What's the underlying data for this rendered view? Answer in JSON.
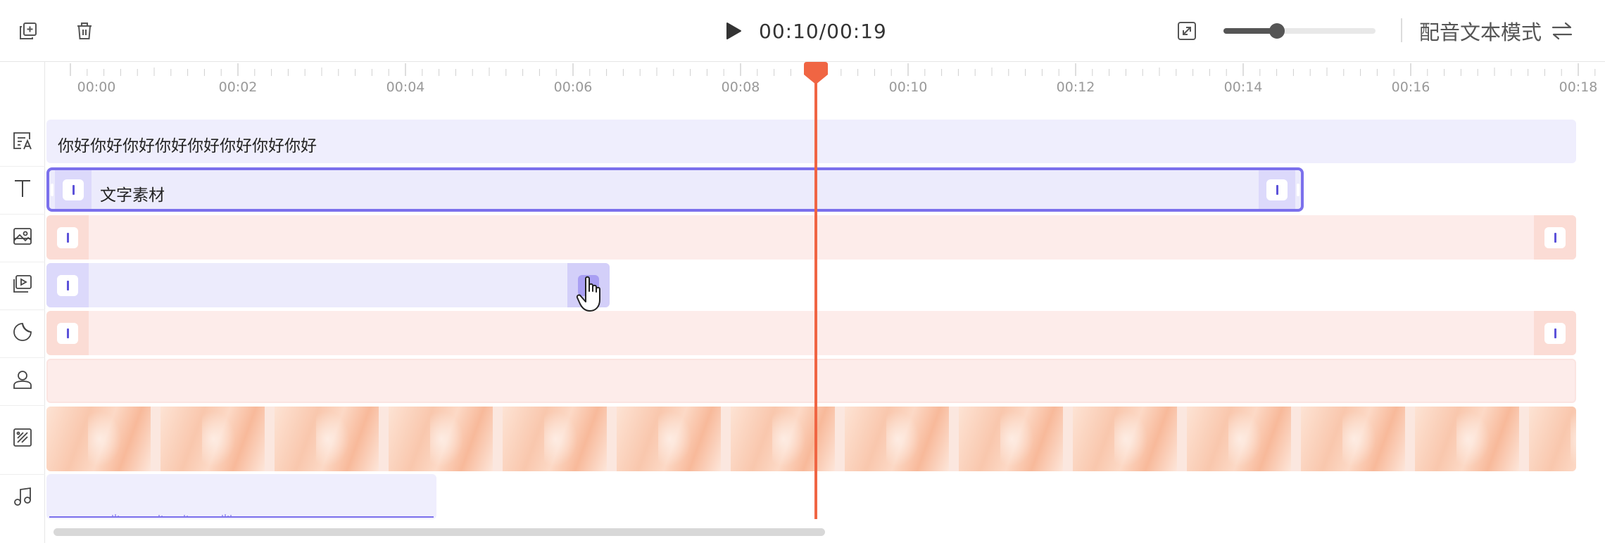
{
  "toolbar": {
    "left_icons": [
      "duplicate-icon",
      "trash-icon"
    ],
    "play_icon": "play-icon",
    "current_time": "00:10",
    "total_time": "00:19",
    "time_display": "00:10/00:19",
    "fullscreen_icon": "expand-icon",
    "zoom_level": 0.35,
    "mode_label": "配音文本模式",
    "mode_switch_icon": "swap-arrows-icon"
  },
  "ruler": {
    "labels": [
      "00:00",
      "00:02",
      "00:04",
      "00:06",
      "00:08",
      "00:10",
      "00:12",
      "00:14",
      "00:16",
      "00:18"
    ],
    "playhead_time_seconds": 9.1
  },
  "tracks": {
    "icons": [
      "dubbing-text-icon",
      "text-icon",
      "image-icon",
      "video-clip-icon",
      "sticker-icon",
      "person-icon",
      "background-icon",
      "music-icon"
    ],
    "dubbing_text": "你好你好你好你好你好你好你好你好",
    "text_clip_label": "文字素材"
  },
  "colors": {
    "accent": "#7b70ec",
    "playhead": "#f06543",
    "pink_track": "#fdecea",
    "purple_track": "#ecebfc"
  }
}
